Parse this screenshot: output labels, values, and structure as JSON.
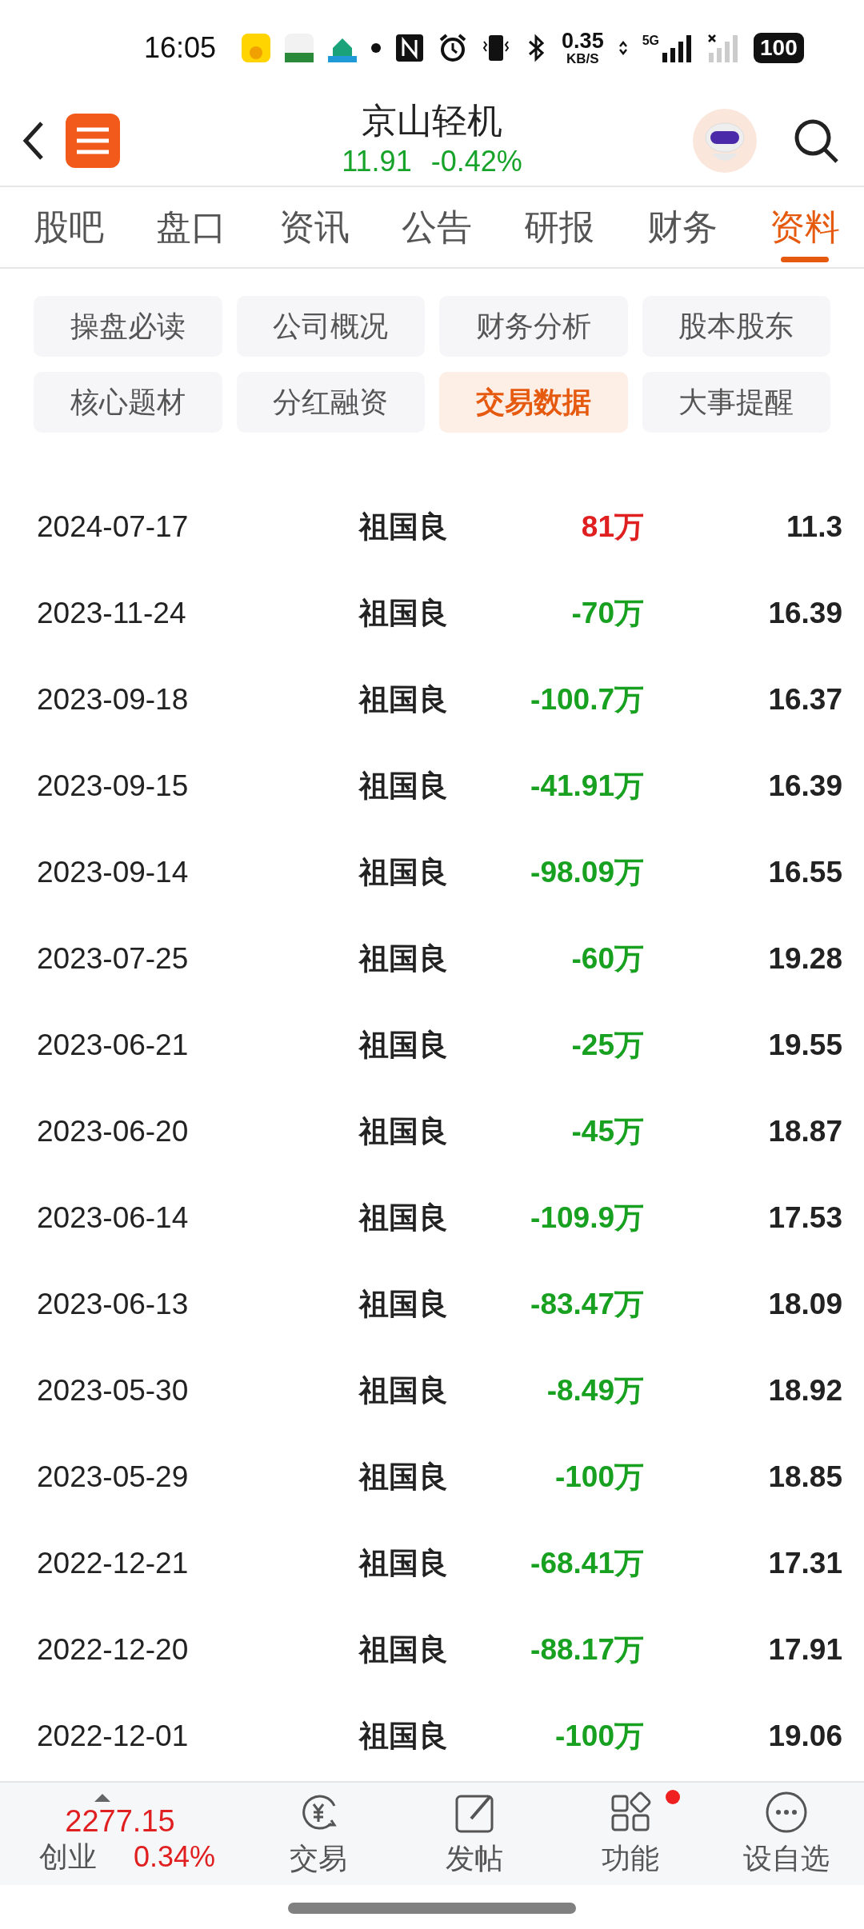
{
  "status_bar": {
    "time": "16:05",
    "net_speed": "0.35",
    "net_unit": "KB/S",
    "network": "5G",
    "battery": "100"
  },
  "header": {
    "title": "京山轻机",
    "price": "11.91",
    "change": "-0.42%"
  },
  "tabs": [
    {
      "label": "股吧",
      "selected": false
    },
    {
      "label": "盘口",
      "selected": false
    },
    {
      "label": "资讯",
      "selected": false
    },
    {
      "label": "公告",
      "selected": false
    },
    {
      "label": "研报",
      "selected": false
    },
    {
      "label": "财务",
      "selected": false
    },
    {
      "label": "资料",
      "selected": true
    }
  ],
  "chips": [
    {
      "label": "操盘必读",
      "selected": false
    },
    {
      "label": "公司概况",
      "selected": false
    },
    {
      "label": "财务分析",
      "selected": false
    },
    {
      "label": "股本股东",
      "selected": false
    },
    {
      "label": "核心题材",
      "selected": false
    },
    {
      "label": "分红融资",
      "selected": false
    },
    {
      "label": "交易数据",
      "selected": true
    },
    {
      "label": "大事提醒",
      "selected": false
    }
  ],
  "rows": [
    {
      "date": "2024-07-17",
      "person": "祖国良",
      "amount": "81万",
      "color": "#e02020",
      "price": "11.3"
    },
    {
      "date": "2023-11-24",
      "person": "祖国良",
      "amount": "-70万",
      "color": "#18a020",
      "price": "16.39"
    },
    {
      "date": "2023-09-18",
      "person": "祖国良",
      "amount": "-100.7万",
      "color": "#18a020",
      "price": "16.37"
    },
    {
      "date": "2023-09-15",
      "person": "祖国良",
      "amount": "-41.91万",
      "color": "#18a020",
      "price": "16.39"
    },
    {
      "date": "2023-09-14",
      "person": "祖国良",
      "amount": "-98.09万",
      "color": "#18a020",
      "price": "16.55"
    },
    {
      "date": "2023-07-25",
      "person": "祖国良",
      "amount": "-60万",
      "color": "#18a020",
      "price": "19.28"
    },
    {
      "date": "2023-06-21",
      "person": "祖国良",
      "amount": "-25万",
      "color": "#18a020",
      "price": "19.55"
    },
    {
      "date": "2023-06-20",
      "person": "祖国良",
      "amount": "-45万",
      "color": "#18a020",
      "price": "18.87"
    },
    {
      "date": "2023-06-14",
      "person": "祖国良",
      "amount": "-109.9万",
      "color": "#18a020",
      "price": "17.53"
    },
    {
      "date": "2023-06-13",
      "person": "祖国良",
      "amount": "-83.47万",
      "color": "#18a020",
      "price": "18.09"
    },
    {
      "date": "2023-05-30",
      "person": "祖国良",
      "amount": "-8.49万",
      "color": "#18a020",
      "price": "18.92"
    },
    {
      "date": "2023-05-29",
      "person": "祖国良",
      "amount": "-100万",
      "color": "#18a020",
      "price": "18.85"
    },
    {
      "date": "2022-12-21",
      "person": "祖国良",
      "amount": "-68.41万",
      "color": "#18a020",
      "price": "17.31"
    },
    {
      "date": "2022-12-20",
      "person": "祖国良",
      "amount": "-88.17万",
      "color": "#18a020",
      "price": "17.91"
    },
    {
      "date": "2022-12-01",
      "person": "祖国良",
      "amount": "-100万",
      "color": "#18a020",
      "price": "19.06"
    }
  ],
  "bottom_bar": {
    "index_value": "2277.15",
    "index_name": "创业",
    "index_change": "0.34%",
    "items": [
      {
        "label": "交易",
        "kind": "trade",
        "badge": false
      },
      {
        "label": "发帖",
        "kind": "post",
        "badge": false
      },
      {
        "label": "功能",
        "kind": "functions",
        "badge": true
      },
      {
        "label": "设自选",
        "kind": "watchlist",
        "badge": false
      }
    ]
  }
}
